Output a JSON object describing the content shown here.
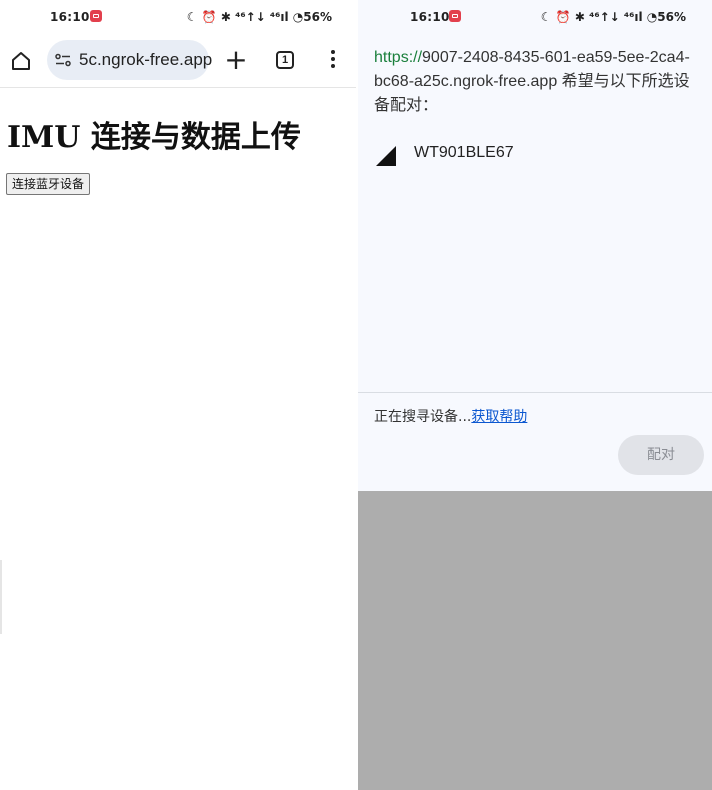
{
  "left": {
    "status": {
      "time": "16:10",
      "icons": "☾ ⏰ ✱ ⁴⁶↑↓ ⁴⁶ıl ◔56%"
    },
    "toolbar": {
      "url": "5c.ngrok-free.app",
      "tab_count": "1",
      "new_tab": "+"
    },
    "page": {
      "title": "IMU 连接与数据上传",
      "connect_button": "连接蓝牙设备"
    }
  },
  "right": {
    "status": {
      "time": "16:10",
      "icons": "☾ ⏰ ✱ ⁴⁶↑↓ ⁴⁶ıl ◔56%"
    },
    "dialog": {
      "origin_scheme": "https://",
      "origin_host": "9007-2408-8435-601-ea59-5ee-2ca4-bc68-a25c.ngrok-free.app",
      "prompt": " 希望与以下所选设备配对：",
      "device_name": "WT901BLE67",
      "searching_text": "正在搜寻设备...",
      "help_link": "获取帮助",
      "pair_button": "配对"
    }
  },
  "colors": {
    "scheme_green": "#1a7f3c",
    "link_blue": "#0b57d0",
    "overlay_gray": "#adadad",
    "dialog_bg": "#f7f9fe"
  }
}
